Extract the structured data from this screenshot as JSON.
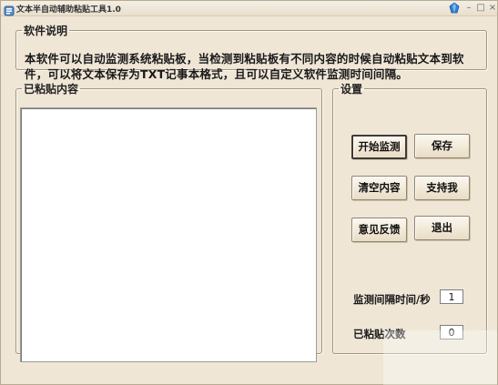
{
  "window": {
    "title": "文本半自动辅助粘贴工具1.0"
  },
  "description": {
    "legend": "软件说明",
    "text": "本软件可以自动监测系统粘贴板，当检测到粘贴板有不同内容的时候自动粘贴文本到软件，可以将文本保存为TXT记事本格式，且可以自定义软件监测时间间隔。"
  },
  "pasted": {
    "legend": "已粘贴内容",
    "content": ""
  },
  "settings": {
    "legend": "设置",
    "buttons": {
      "start_monitor": "开始监测",
      "save": "保存",
      "clear": "清空内容",
      "support": "支持我",
      "feedback": "意见反馈",
      "exit": "退出"
    },
    "interval_label": "监测间隔时间/秒",
    "interval_value": "1",
    "count_label": "已粘贴次数",
    "count_value": "0"
  },
  "icons": {
    "app": "app-icon",
    "skin": "skin-gem-icon",
    "minimize": "minimize-icon",
    "maximize": "maximize-icon",
    "close": "close-icon"
  },
  "colors": {
    "background": "#efe6d6",
    "skin_icon": "#2f7fd8"
  }
}
